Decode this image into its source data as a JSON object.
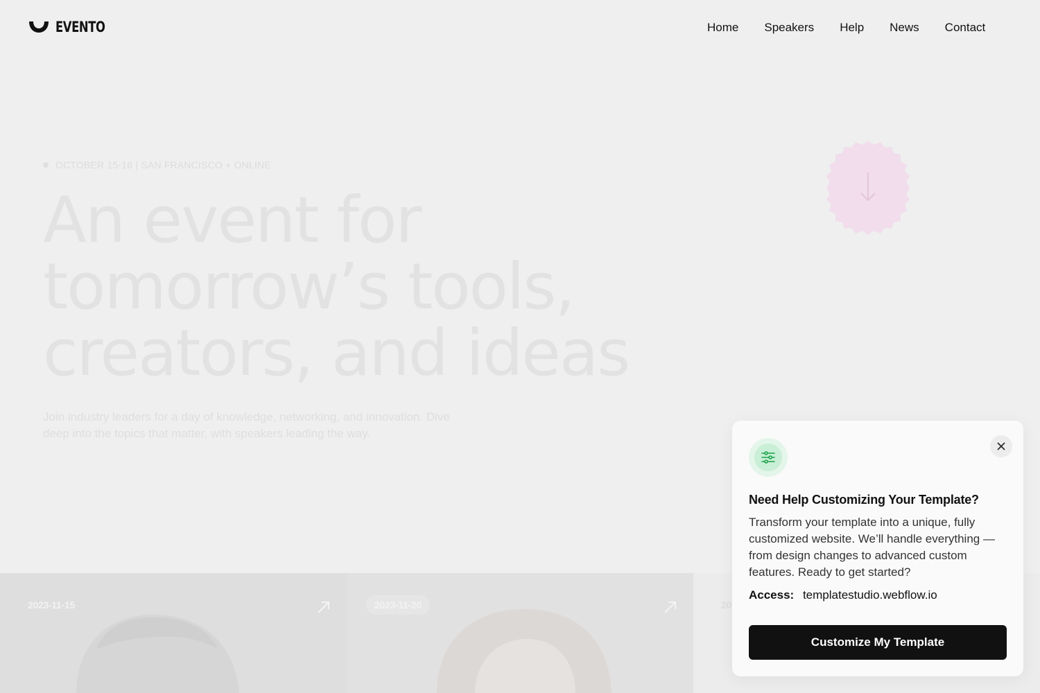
{
  "header": {
    "logo_text": "EVENTO",
    "nav": [
      "Home",
      "Speakers",
      "Help",
      "News",
      "Contact"
    ]
  },
  "hero": {
    "eyebrow": "OCTOBER 15-16 | SAN FRANCISCO + ONLINE",
    "headline_lines": [
      "An event for",
      "tomorrow’s tools,",
      "creators, and ideas"
    ],
    "subtext": "Join industry leaders for a day of knowledge, networking, and innovation. Dive deep into the topics that matter, with speakers leading the way.",
    "badge_icon": "arrow-down-icon"
  },
  "cards": [
    {
      "date": "2023-11-15"
    },
    {
      "date": "2023-11-20"
    },
    {
      "date": "20"
    }
  ],
  "popup": {
    "icon": "sliders-icon",
    "title": "Need Help Customizing Your Template?",
    "body": "Transform your template into a unique, fully customized website. We’ll handle everything — from design changes to advanced custom features. Ready to get started?",
    "access_label": "Access:",
    "access_value": "templatestudio.webflow.io",
    "cta_label": "Customize My Template"
  },
  "colors": {
    "background": "#efefef",
    "accent_green": "#1aa34a",
    "cta_bg": "#111111",
    "badge_pink": "#f1ddec"
  }
}
